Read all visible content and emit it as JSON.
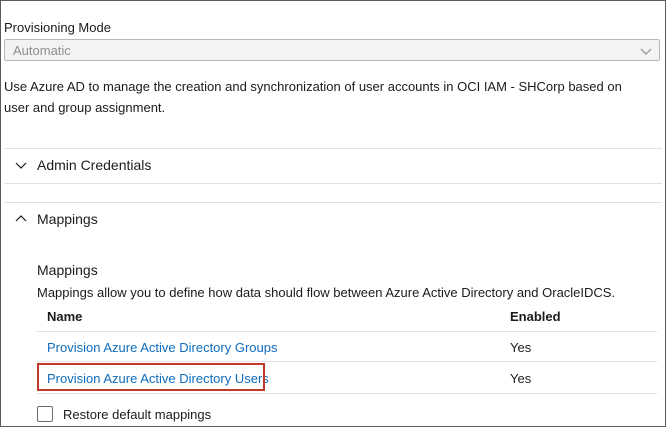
{
  "provisioning": {
    "label": "Provisioning Mode",
    "mode_value": "Automatic",
    "description": "Use Azure AD to manage the creation and synchronization of user accounts in OCI IAM - SHCorp based on user and group assignment."
  },
  "sections": {
    "admin_credentials": "Admin Credentials",
    "mappings": "Mappings"
  },
  "mappings": {
    "title": "Mappings",
    "description": "Mappings allow you to define how data should flow between Azure Active Directory and OracleIDCS.",
    "columns": {
      "name": "Name",
      "enabled": "Enabled"
    },
    "rows": [
      {
        "name": "Provision Azure Active Directory Groups",
        "enabled": "Yes"
      },
      {
        "name": "Provision Azure Active Directory Users",
        "enabled": "Yes"
      }
    ],
    "restore_label": "Restore default mappings"
  },
  "colors": {
    "link": "#0f6cbd",
    "highlight_border": "#c0392b"
  }
}
